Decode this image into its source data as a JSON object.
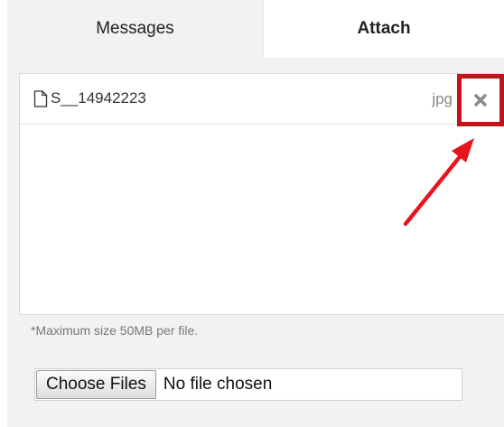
{
  "tabs": [
    {
      "label": "Messages",
      "active": false
    },
    {
      "label": "Attach",
      "active": true
    }
  ],
  "attachment": {
    "name": "S__14942223",
    "extension": "jpg",
    "icon": "file-icon",
    "remove_icon": "close-icon"
  },
  "note": "*Maximum size 50MB per file.",
  "file_input": {
    "button_label": "Choose Files",
    "status": "No file chosen"
  },
  "colors": {
    "highlight": "#c4121a",
    "arrow": "#e8141c",
    "tab_inactive_bg": "#f2f2f2"
  }
}
